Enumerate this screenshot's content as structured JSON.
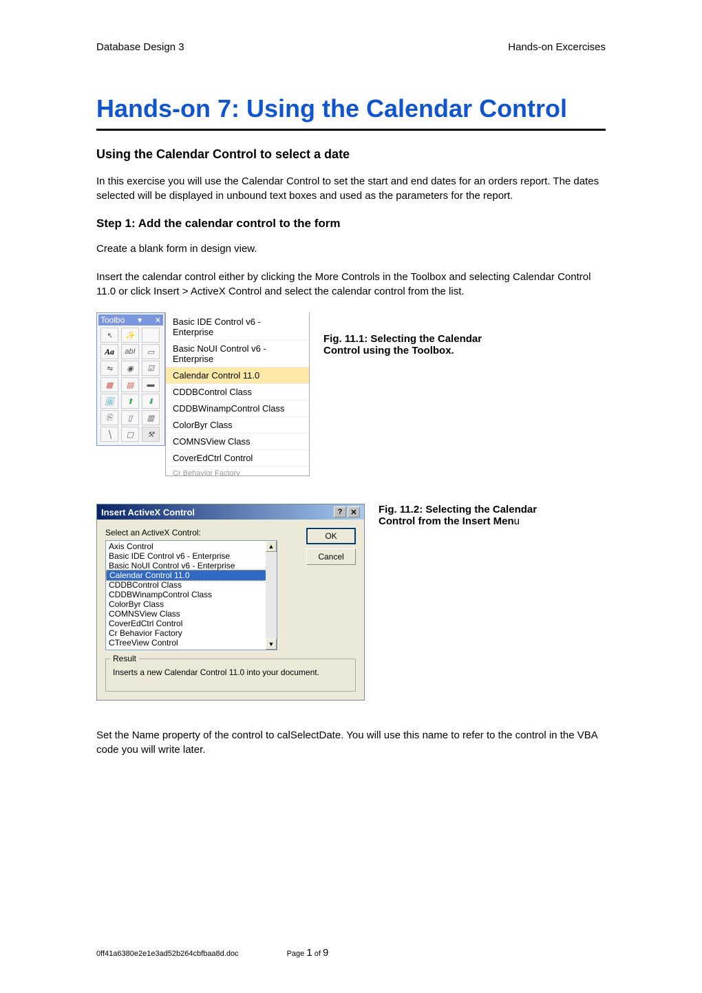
{
  "header": {
    "left": "Database Design 3",
    "right": "Hands-on Excercises"
  },
  "title": "Hands-on 7: Using the Calendar Control",
  "section1_title": "Using the Calendar Control to select a date",
  "section1_body": "In this exercise you will use the Calendar Control to set the start and end dates for an orders report. The dates selected will be displayed in unbound text boxes and used as the parameters for the report.",
  "step1_title": "Step 1: Add the calendar control to the form",
  "step1_p1": "Create a blank form in design view.",
  "step1_p2": "Insert the calendar control either by clicking the More Controls in the Toolbox and selecting Calendar Control 11.0 or click Insert > ActiveX Control and select the calendar control from the list.",
  "toolbox": {
    "title": "Toolbo",
    "menu_items": [
      "Basic IDE Control v6 - Enterprise",
      "Basic NoUI Control v6 - Enterprise",
      "Calendar Control 11.0",
      "CDDBControl Class",
      "CDDBWinampControl Class",
      "ColorByr Class",
      "COMNSView Class",
      "CoverEdCtrl Control"
    ],
    "menu_partial": "Cr Behavior Factory",
    "selected_index": 2,
    "tool_aa": "Aa",
    "tool_abl": "abI"
  },
  "fig1_caption": "Fig. 11.1: Selecting the Calendar Control using the Toolbox.",
  "dialog": {
    "title": "Insert ActiveX Control",
    "label": "Select an ActiveX Control:",
    "items": [
      "Axis Control",
      "Basic IDE Control v6 - Enterprise",
      "Basic NoUI Control v6 - Enterprise",
      "Calendar Control 11.0",
      "CDDBControl Class",
      "CDDBWinampControl Class",
      "ColorByr Class",
      "COMNSView Class",
      "CoverEdCtrl Control",
      "Cr Behavior Factory",
      "CTreeView Control"
    ],
    "selected_index": 3,
    "ok": "OK",
    "cancel": "Cancel",
    "result_legend": "Result",
    "result_text": "Inserts a new Calendar Control 11.0 into your document."
  },
  "fig2_caption_prefix": " Fig. 11.2: Selecting the Calendar Control from the Insert Men",
  "fig2_caption_suffix": "u",
  "closing_p": "Set the Name property of the control to calSelectDate. You will use this name to refer to the control in the VBA code you will write later.",
  "footer": {
    "filename": "0ff41a6380e2e1e3ad52b264cbfbaa8d.doc",
    "page_label": "Page ",
    "page_current": "1",
    "page_of": " of ",
    "page_total": "9"
  }
}
